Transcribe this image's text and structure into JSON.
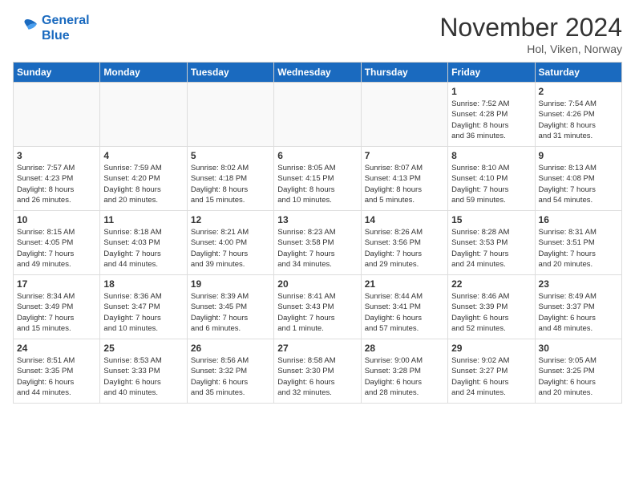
{
  "header": {
    "logo_line1": "General",
    "logo_line2": "Blue",
    "month_title": "November 2024",
    "location": "Hol, Viken, Norway"
  },
  "weekdays": [
    "Sunday",
    "Monday",
    "Tuesday",
    "Wednesday",
    "Thursday",
    "Friday",
    "Saturday"
  ],
  "weeks": [
    [
      {
        "day": "",
        "info": ""
      },
      {
        "day": "",
        "info": ""
      },
      {
        "day": "",
        "info": ""
      },
      {
        "day": "",
        "info": ""
      },
      {
        "day": "",
        "info": ""
      },
      {
        "day": "1",
        "info": "Sunrise: 7:52 AM\nSunset: 4:28 PM\nDaylight: 8 hours\nand 36 minutes."
      },
      {
        "day": "2",
        "info": "Sunrise: 7:54 AM\nSunset: 4:26 PM\nDaylight: 8 hours\nand 31 minutes."
      }
    ],
    [
      {
        "day": "3",
        "info": "Sunrise: 7:57 AM\nSunset: 4:23 PM\nDaylight: 8 hours\nand 26 minutes."
      },
      {
        "day": "4",
        "info": "Sunrise: 7:59 AM\nSunset: 4:20 PM\nDaylight: 8 hours\nand 20 minutes."
      },
      {
        "day": "5",
        "info": "Sunrise: 8:02 AM\nSunset: 4:18 PM\nDaylight: 8 hours\nand 15 minutes."
      },
      {
        "day": "6",
        "info": "Sunrise: 8:05 AM\nSunset: 4:15 PM\nDaylight: 8 hours\nand 10 minutes."
      },
      {
        "day": "7",
        "info": "Sunrise: 8:07 AM\nSunset: 4:13 PM\nDaylight: 8 hours\nand 5 minutes."
      },
      {
        "day": "8",
        "info": "Sunrise: 8:10 AM\nSunset: 4:10 PM\nDaylight: 7 hours\nand 59 minutes."
      },
      {
        "day": "9",
        "info": "Sunrise: 8:13 AM\nSunset: 4:08 PM\nDaylight: 7 hours\nand 54 minutes."
      }
    ],
    [
      {
        "day": "10",
        "info": "Sunrise: 8:15 AM\nSunset: 4:05 PM\nDaylight: 7 hours\nand 49 minutes."
      },
      {
        "day": "11",
        "info": "Sunrise: 8:18 AM\nSunset: 4:03 PM\nDaylight: 7 hours\nand 44 minutes."
      },
      {
        "day": "12",
        "info": "Sunrise: 8:21 AM\nSunset: 4:00 PM\nDaylight: 7 hours\nand 39 minutes."
      },
      {
        "day": "13",
        "info": "Sunrise: 8:23 AM\nSunset: 3:58 PM\nDaylight: 7 hours\nand 34 minutes."
      },
      {
        "day": "14",
        "info": "Sunrise: 8:26 AM\nSunset: 3:56 PM\nDaylight: 7 hours\nand 29 minutes."
      },
      {
        "day": "15",
        "info": "Sunrise: 8:28 AM\nSunset: 3:53 PM\nDaylight: 7 hours\nand 24 minutes."
      },
      {
        "day": "16",
        "info": "Sunrise: 8:31 AM\nSunset: 3:51 PM\nDaylight: 7 hours\nand 20 minutes."
      }
    ],
    [
      {
        "day": "17",
        "info": "Sunrise: 8:34 AM\nSunset: 3:49 PM\nDaylight: 7 hours\nand 15 minutes."
      },
      {
        "day": "18",
        "info": "Sunrise: 8:36 AM\nSunset: 3:47 PM\nDaylight: 7 hours\nand 10 minutes."
      },
      {
        "day": "19",
        "info": "Sunrise: 8:39 AM\nSunset: 3:45 PM\nDaylight: 7 hours\nand 6 minutes."
      },
      {
        "day": "20",
        "info": "Sunrise: 8:41 AM\nSunset: 3:43 PM\nDaylight: 7 hours\nand 1 minute."
      },
      {
        "day": "21",
        "info": "Sunrise: 8:44 AM\nSunset: 3:41 PM\nDaylight: 6 hours\nand 57 minutes."
      },
      {
        "day": "22",
        "info": "Sunrise: 8:46 AM\nSunset: 3:39 PM\nDaylight: 6 hours\nand 52 minutes."
      },
      {
        "day": "23",
        "info": "Sunrise: 8:49 AM\nSunset: 3:37 PM\nDaylight: 6 hours\nand 48 minutes."
      }
    ],
    [
      {
        "day": "24",
        "info": "Sunrise: 8:51 AM\nSunset: 3:35 PM\nDaylight: 6 hours\nand 44 minutes."
      },
      {
        "day": "25",
        "info": "Sunrise: 8:53 AM\nSunset: 3:33 PM\nDaylight: 6 hours\nand 40 minutes."
      },
      {
        "day": "26",
        "info": "Sunrise: 8:56 AM\nSunset: 3:32 PM\nDaylight: 6 hours\nand 35 minutes."
      },
      {
        "day": "27",
        "info": "Sunrise: 8:58 AM\nSunset: 3:30 PM\nDaylight: 6 hours\nand 32 minutes."
      },
      {
        "day": "28",
        "info": "Sunrise: 9:00 AM\nSunset: 3:28 PM\nDaylight: 6 hours\nand 28 minutes."
      },
      {
        "day": "29",
        "info": "Sunrise: 9:02 AM\nSunset: 3:27 PM\nDaylight: 6 hours\nand 24 minutes."
      },
      {
        "day": "30",
        "info": "Sunrise: 9:05 AM\nSunset: 3:25 PM\nDaylight: 6 hours\nand 20 minutes."
      }
    ]
  ]
}
